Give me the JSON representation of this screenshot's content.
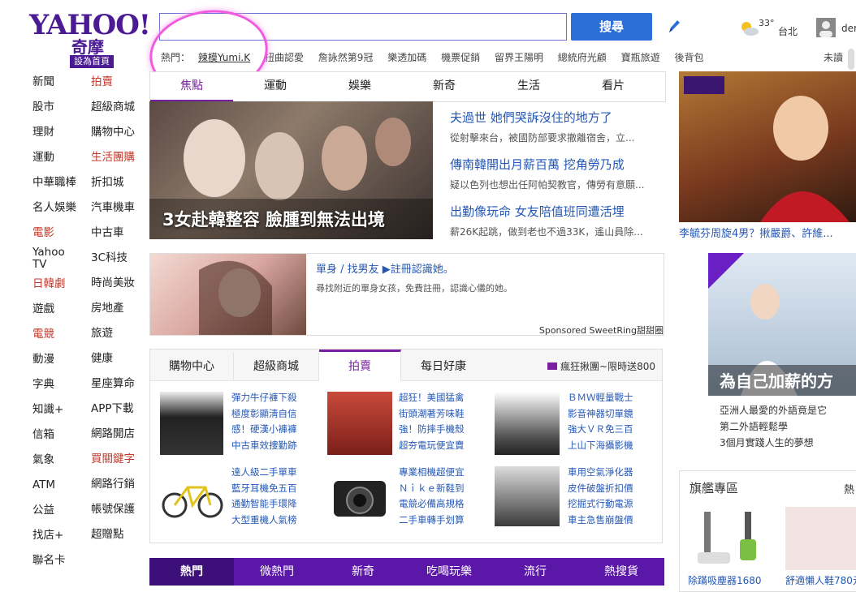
{
  "logo": {
    "brand": "YAHOO!",
    "sub": "奇摩",
    "set_home": "設為首頁"
  },
  "search": {
    "button": "搜尋",
    "value": ""
  },
  "weather": {
    "temp": "33°",
    "city": "台北",
    "user_partial": "der"
  },
  "hot": {
    "label": "熱門：",
    "items": [
      "辣模Yumi.K",
      "扭曲認愛",
      "詹詠然第9冠",
      "樂透加碼",
      "機票促銷",
      "留界王陽明",
      "總統府光顧",
      "寶瓶旅遊",
      "後背包"
    ],
    "right": "未讀"
  },
  "left_nav": {
    "col1": [
      {
        "label": "新聞",
        "red": false
      },
      {
        "label": "股市",
        "red": false
      },
      {
        "label": "理財",
        "red": false
      },
      {
        "label": "運動",
        "red": false
      },
      {
        "label": "中華職棒",
        "red": false
      },
      {
        "label": "名人娛樂",
        "red": false
      },
      {
        "label": "電影",
        "red": true
      },
      {
        "label": "Yahoo TV",
        "red": false
      },
      {
        "label": "日韓劇",
        "red": true
      },
      {
        "label": "遊戲",
        "red": false
      },
      {
        "label": "電競",
        "red": true
      },
      {
        "label": "動漫",
        "red": false
      },
      {
        "label": "字典",
        "red": false
      },
      {
        "label": "知識+",
        "red": false
      },
      {
        "label": "信箱",
        "red": false
      },
      {
        "label": "氣象",
        "red": false
      },
      {
        "label": "ATM",
        "red": false
      },
      {
        "label": "公益",
        "red": false
      },
      {
        "label": "找店+",
        "red": false
      },
      {
        "label": "聯名卡",
        "red": false
      }
    ],
    "col2": [
      {
        "label": "拍賣",
        "red": true
      },
      {
        "label": "超級商城",
        "red": false
      },
      {
        "label": "購物中心",
        "red": false
      },
      {
        "label": "生活團購",
        "red": true
      },
      {
        "label": "折扣城",
        "red": false
      },
      {
        "label": "汽車機車",
        "red": false
      },
      {
        "label": "中古車",
        "red": false
      },
      {
        "label": "3C科技",
        "red": false
      },
      {
        "label": "時尚美妝",
        "red": false
      },
      {
        "label": "房地產",
        "red": false
      },
      {
        "label": "旅遊",
        "red": false
      },
      {
        "label": "健康",
        "red": false
      },
      {
        "label": "星座算命",
        "red": false
      },
      {
        "label": "APP下載",
        "red": false
      },
      {
        "label": "網路開店",
        "red": false
      },
      {
        "label": "買關鍵字",
        "red": true
      },
      {
        "label": "網路行銷",
        "red": false
      },
      {
        "label": "帳號保護",
        "red": false
      },
      {
        "label": "超贈點",
        "red": false
      }
    ]
  },
  "news_tabs": [
    "焦點",
    "運動",
    "娛樂",
    "新奇",
    "生活",
    "看片"
  ],
  "hero": {
    "caption": "3女赴韓整容 臉腫到無法出境"
  },
  "news": [
    {
      "title": "夫過世 她們哭訴沒住的地方了",
      "sub": "從射擊來台，被國防部要求撤離宿舍，立..."
    },
    {
      "title": "傳南韓開出月薪百萬 挖角勞乃成",
      "sub": "疑以色列也想出任阿帕契教官，傳勞有意願..."
    },
    {
      "title": "出勤像玩命 女友陪值班同遭活埋",
      "sub": "薪26K起跳，做到老也不過33K，遙山員除..."
    }
  ],
  "ad": {
    "title": "單身 / 找男友 ▶註冊認識她。",
    "sub": "尋找附近的單身女孩，免費註冊，認識心儀的她。",
    "sponsor": "Sponsored SweetRing甜甜圈"
  },
  "shop": {
    "tabs": [
      "購物中心",
      "超級商城",
      "拍賣",
      "每日好康"
    ],
    "promo": "瘋狂揪團~限時送800",
    "products": [
      "彈力牛仔褲下殺\n極度彰顯淸自信\n感！硬漢小褲褲\n中古車效捜勤跡",
      "超狂！美國猛禽\n街頭潮著芳味鞋\n強！防摔手機殼\n超夯電玩便宜賣",
      "ＢＭＷ輕量戰士\n影音神器切單鏡\n強大ＶＲ免三百\n上山下海攝影機",
      "達人級二手單車\n藍牙耳機免五百\n通勤智能手環降\n大型重機人氣榜",
      "專業相機超便宜\nＮｉｋｅ新鞋到\n電競必備高規格\n二手車轉手划算",
      "車用空氣淨化器\n皮件破盤折扣價\n挖掘式行動電源\n車主急售崩盤價"
    ]
  },
  "bottom_tabs": [
    "熱門",
    "微熱門",
    "新奇",
    "吃喝玩樂",
    "流行",
    "熱搜貨"
  ],
  "video": {
    "caption": "李毓芬周旋4男？揪嚴爵、許維..."
  },
  "promo": {
    "caption": "為自己加薪的方",
    "lines": [
      "亞洲人最愛的外語竟是它",
      "第二外語輕鬆學",
      "3個月實踐人生的夢想"
    ]
  },
  "flagship": {
    "title": "旗艦專區",
    "more": "熱",
    "items": [
      "除蹣吸塵器1680",
      "舒適懶人鞋780元"
    ]
  }
}
